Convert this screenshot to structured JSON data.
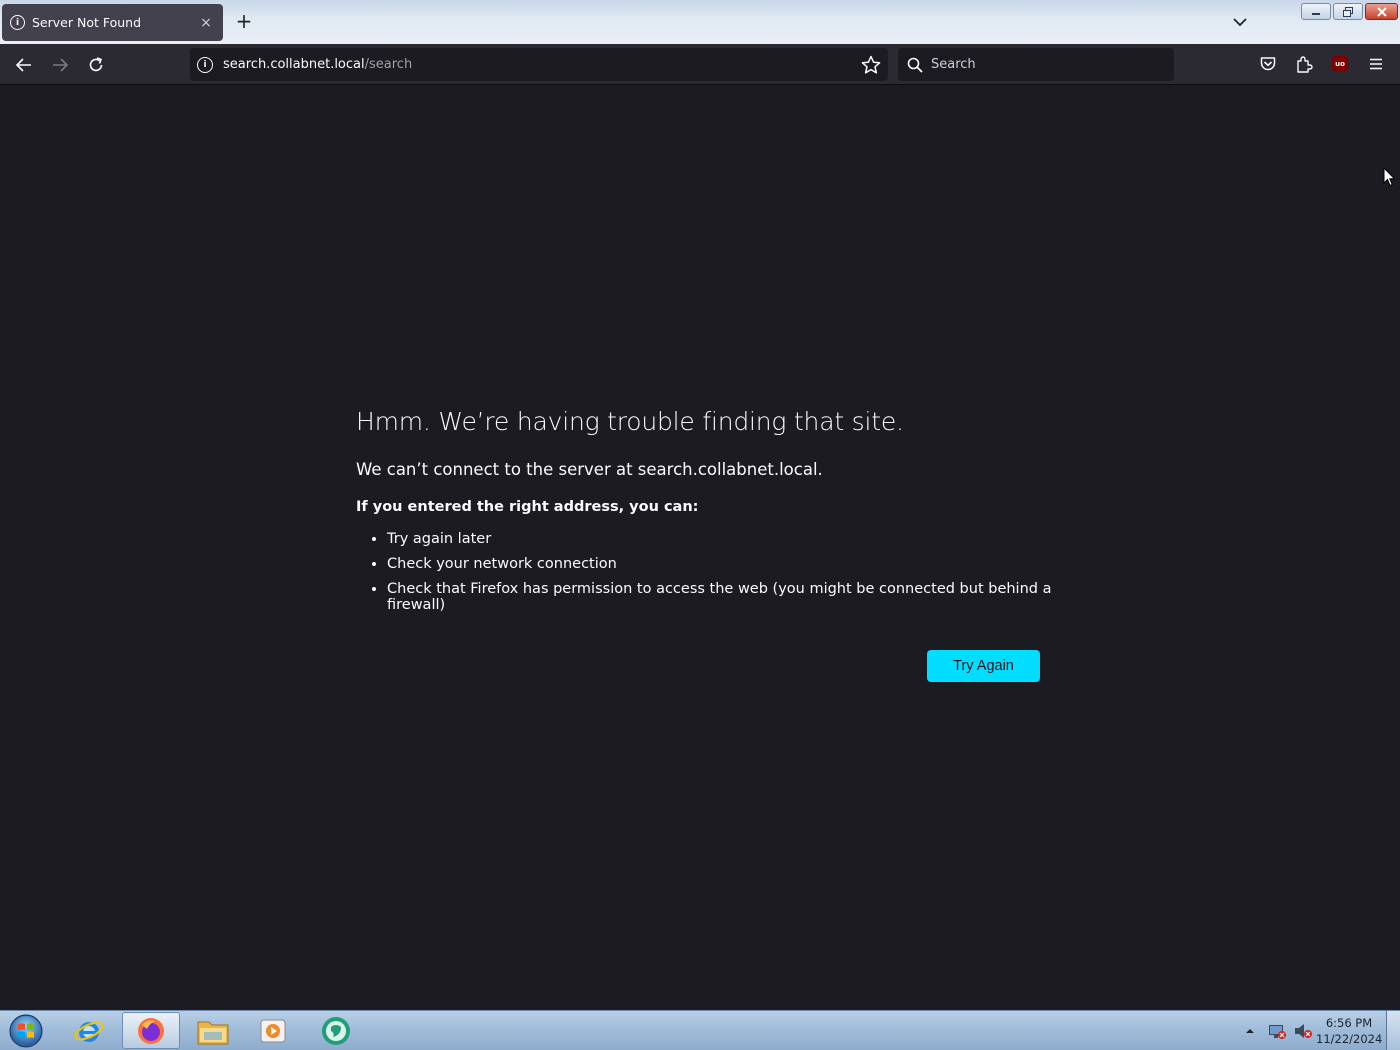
{
  "browser": {
    "tab": {
      "title": "Server Not Found",
      "close_glyph": "×"
    },
    "new_tab_glyph": "+",
    "urlbar": {
      "host": "search.collabnet.local",
      "path": "/search"
    },
    "searchbar": {
      "placeholder": "Search"
    },
    "ublock_label": "uo"
  },
  "error_page": {
    "title": "Hmm. We’re having trouble finding that site.",
    "description": "We can’t connect to the server at search.collabnet.local.",
    "prompt": "If you entered the right address, you can:",
    "suggestions": [
      "Try again later",
      "Check your network connection",
      "Check that Firefox has permission to access the web (you might be connected but behind a firewall)"
    ],
    "try_again_label": "Try Again"
  },
  "taskbar": {
    "apps": [
      "internet-explorer-icon",
      "firefox-icon",
      "file-explorer-icon",
      "media-player-icon",
      "chat-app-icon"
    ],
    "clock": {
      "time": "6:56 PM",
      "date": "11/22/2024"
    }
  },
  "colors": {
    "accent": "#00ddff",
    "page_bg": "#1c1b22",
    "toolbar_bg": "#2b2a33"
  }
}
